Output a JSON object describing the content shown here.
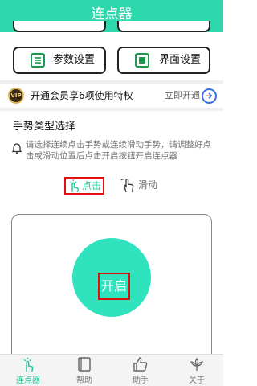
{
  "header": {
    "title": "连点器"
  },
  "settings": {
    "params_label": "参数设置",
    "ui_label": "界面设置"
  },
  "vip": {
    "badge": "VIP",
    "text": "开通会员享6项使用特权",
    "link": "立即开通"
  },
  "gesture": {
    "title": "手势类型选择",
    "hint": "请选择连续点击手势或连续滑动手势，请调整好点击或滑动位置后点击开启按钮开启连点器",
    "click_label": "点击",
    "slide_label": "滑动",
    "selected": "点击"
  },
  "start": {
    "label": "开启"
  },
  "tabs": [
    {
      "label": "连点器",
      "icon": "tap-icon"
    },
    {
      "label": "帮助",
      "icon": "book-icon"
    },
    {
      "label": "助手",
      "icon": "thumbs-up-icon"
    },
    {
      "label": "关于",
      "icon": "lotus-icon"
    }
  ],
  "colors": {
    "accent": "#2fd8ac",
    "start_button": "#2fe3be",
    "highlight_border": "#e01010",
    "selected_text": "#21c89b"
  }
}
